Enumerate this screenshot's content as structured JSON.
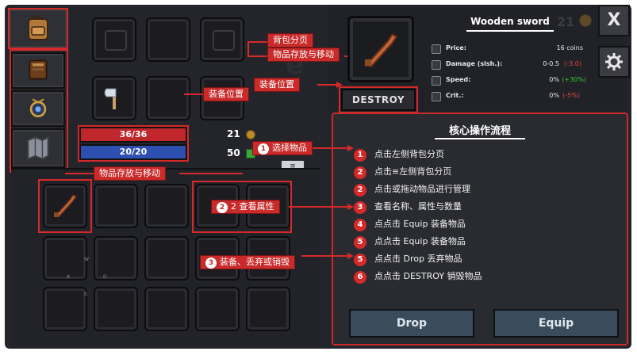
{
  "item": {
    "name": "Wooden sword",
    "level": "21",
    "destroy_label": "DESTROY",
    "stats": [
      {
        "label": "Price:",
        "value": "16 coins",
        "delta": ""
      },
      {
        "label": "Damage (slsh.):",
        "value": "0-0.5",
        "delta": "(-3.0)"
      },
      {
        "label": "Speed:",
        "value": "0%",
        "delta": "(+30%)"
      },
      {
        "label": "Crit.:",
        "value": "0%",
        "delta": "(-5%)"
      }
    ]
  },
  "player": {
    "hp": "36/36",
    "mp": "20/20",
    "coins": "21",
    "gems": "50"
  },
  "window_controls": {
    "close_label": "X",
    "settings_icon": "gear-icon"
  },
  "annotations": {
    "backpack_page": "背包分页",
    "item_store_move_top": "物品存放与移动",
    "equip_position_top": "装备位置",
    "equip_position_left": "装备位置",
    "item_store_move_bottom": "物品存放与移动",
    "select_item": {
      "num": "1",
      "label": "选择物品"
    },
    "view_props": {
      "num": "2",
      "label": "2 查看属性"
    },
    "equip_drop": {
      "num": "3",
      "label": "装备、丢弃或销毁"
    }
  },
  "flow": {
    "title": "核心操作流程",
    "steps": [
      {
        "num": "1",
        "text": "点击左侧背包分页"
      },
      {
        "num": "2",
        "text": "点击≡左侧背包分页"
      },
      {
        "num": "2",
        "text": "点击或拖动物品进行管理"
      },
      {
        "num": "3",
        "text": "查看名称、属性与数量"
      },
      {
        "num": "4",
        "text": "点点击 Equip 装备物品"
      },
      {
        "num": "5",
        "text": "点点击 Equip 装备物品"
      },
      {
        "num": "5",
        "text": "点点击 Drop 丢弃物品"
      },
      {
        "num": "6",
        "text": "点点击 DESTROY 销毁物品"
      }
    ]
  },
  "buttons": {
    "drop": "Drop",
    "equip": "Equip"
  },
  "key_hints": [
    "W",
    "A",
    "D",
    "S"
  ],
  "colors": {
    "accent": "#d62a2a",
    "hp": "#c0272d",
    "mp": "#2c4fb0",
    "panel": "#24252a"
  }
}
